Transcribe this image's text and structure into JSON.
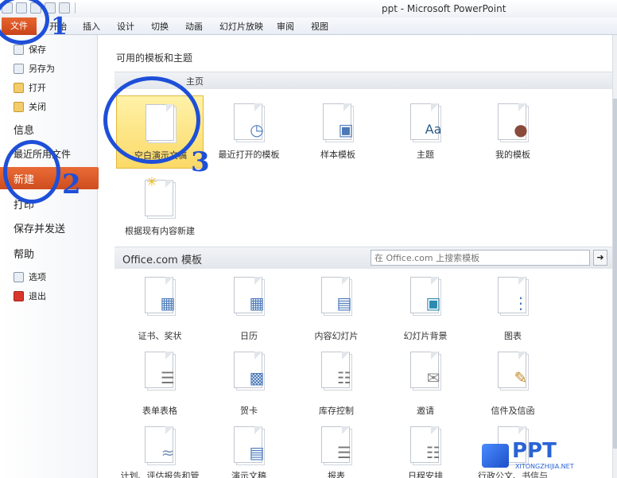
{
  "window": {
    "title": "ppt - Microsoft PowerPoint"
  },
  "ribbon": {
    "tabs": [
      "文件",
      "开始",
      "插入",
      "设计",
      "切换",
      "动画",
      "幻灯片放映",
      "审阅",
      "视图"
    ]
  },
  "backstage": {
    "items": [
      {
        "label": "保存",
        "icon": "save-icon"
      },
      {
        "label": "另存为",
        "icon": "save-as-icon"
      },
      {
        "label": "打开",
        "icon": "open-folder-icon"
      },
      {
        "label": "关闭",
        "icon": "close-folder-icon"
      },
      {
        "label": "信息"
      },
      {
        "label": "最近所用文件"
      },
      {
        "label": "新建"
      },
      {
        "label": "打印"
      },
      {
        "label": "保存并发送"
      },
      {
        "label": "帮助"
      },
      {
        "label": "选项",
        "icon": "options-icon"
      },
      {
        "label": "退出",
        "icon": "exit-icon"
      }
    ],
    "selected": "新建"
  },
  "main": {
    "title": "可用的模板和主题",
    "home_section": "主页",
    "home_tiles": [
      {
        "label": "空白演示文稿",
        "icon": "blank-document-icon"
      },
      {
        "label": "最近打开的模板",
        "icon": "clock-icon"
      },
      {
        "label": "样本模板",
        "icon": "monitor-icon"
      },
      {
        "label": "主题",
        "icon": "theme-icon"
      },
      {
        "label": "我的模板",
        "icon": "user-icon"
      },
      {
        "label": "根据现有内容新建",
        "icon": "new-from-existing-icon"
      }
    ],
    "office_section": "Office.com 模板",
    "search_placeholder": "在 Office.com 上搜索模板",
    "office_tiles": [
      {
        "label": "证书、奖状",
        "icon": "certificate-icon"
      },
      {
        "label": "日历",
        "icon": "calendar-icon"
      },
      {
        "label": "内容幻灯片",
        "icon": "presentation-icon"
      },
      {
        "label": "幻灯片背景",
        "icon": "slide-background-icon"
      },
      {
        "label": "图表",
        "icon": "diagram-icon"
      },
      {
        "label": "表单表格",
        "icon": "form-icon"
      },
      {
        "label": "贺卡",
        "icon": "greeting-card-icon"
      },
      {
        "label": "库存控制",
        "icon": "inventory-icon"
      },
      {
        "label": "邀请",
        "icon": "invitation-icon"
      },
      {
        "label": "信件及信函",
        "icon": "letter-icon"
      },
      {
        "label": "计划、评估报告和管",
        "icon": "plan-icon"
      },
      {
        "label": "演示文稿",
        "icon": "presentation-file-icon"
      },
      {
        "label": "报表",
        "icon": "report-icon"
      },
      {
        "label": "日程安排",
        "icon": "schedule-icon"
      },
      {
        "label": "行政公文、书信与",
        "icon": "document-icon"
      }
    ]
  },
  "annotations": {
    "step1": "1",
    "step2": "2",
    "step3": "3"
  },
  "watermark": {
    "brand": "PPT",
    "url": "XITONGZHIJIA.NET"
  }
}
